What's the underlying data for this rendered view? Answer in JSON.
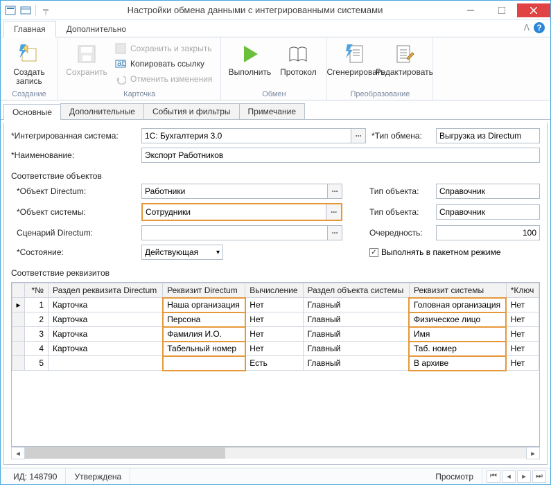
{
  "title": "Настройки обмена данными с интегрированными системами",
  "ribbon": {
    "tabs": {
      "main": "Главная",
      "extra": "Дополнительно"
    },
    "create": "Создать запись",
    "save": "Сохранить",
    "save_close": "Сохранить и закрыть",
    "copy_link": "Копировать ссылку",
    "cancel_changes": "Отменить изменения",
    "execute": "Выполнить",
    "protocol": "Протокол",
    "generate": "Сгенерировать",
    "edit": "Редактировать",
    "groups": {
      "creation": "Создание",
      "card": "Карточка",
      "exchange": "Обмен",
      "transform": "Преобразование"
    }
  },
  "pageTabs": {
    "main": "Основные",
    "extra": "Дополнительные",
    "events": "События и фильтры",
    "note": "Примечание"
  },
  "form": {
    "integratedSystemLabel": "*Интегрированная система:",
    "integratedSystemValue": "1С: Бухгалтерия 3.0",
    "exchangeTypeLabel": "*Тип обмена:",
    "exchangeTypeValue": "Выгрузка из Directum",
    "nameLabel": "*Наименование:",
    "nameValue": "Экспорт Работников",
    "objectsMapLabel": "Соответствие объектов",
    "directumObjectLabel": "*Объект Directum:",
    "directumObjectValue": "Работники",
    "objectTypeLabel": "Тип объекта:",
    "objectTypeValue1": "Справочник",
    "systemObjectLabel": "*Объект системы:",
    "systemObjectValue": "Сотрудники",
    "objectTypeValue2": "Справочник",
    "directumScenarioLabel": "Сценарий Directum:",
    "directumScenarioValue": "",
    "orderLabel": "Очередность:",
    "orderValue": "100",
    "stateLabel": "*Состояние:",
    "stateValue": "Действующая",
    "batchModeLabel": "Выполнять в пакетном режиме",
    "reqMapLabel": "Соответствие реквизитов"
  },
  "table": {
    "headers": {
      "num": "*№",
      "section": "Раздел реквизита Directum",
      "req_directum": "Реквизит Directum",
      "calc": "Вычисление",
      "sys_section": "Раздел объекта системы",
      "sys_req": "Реквизит системы",
      "key": "*Ключ"
    },
    "rows": [
      {
        "n": "1",
        "section": "Карточка",
        "req": "Наша организация",
        "calc": "Нет",
        "sys_sec": "Главный",
        "sys_req": "Головная организация",
        "key": "Нет"
      },
      {
        "n": "2",
        "section": "Карточка",
        "req": "Персона",
        "calc": "Нет",
        "sys_sec": "Главный",
        "sys_req": "Физическое лицо",
        "key": "Нет"
      },
      {
        "n": "3",
        "section": "Карточка",
        "req": "Фамилия И.О.",
        "calc": "Нет",
        "sys_sec": "Главный",
        "sys_req": "Имя",
        "key": "Нет"
      },
      {
        "n": "4",
        "section": "Карточка",
        "req": "Табельный номер",
        "calc": "Нет",
        "sys_sec": "Главный",
        "sys_req": "Таб. номер",
        "key": "Нет"
      },
      {
        "n": "5",
        "section": "",
        "req": "",
        "calc": "Есть",
        "sys_sec": "Главный",
        "sys_req": "В архиве",
        "key": "Нет"
      }
    ]
  },
  "status": {
    "id": "ИД: 148790",
    "state": "Утверждена",
    "preview": "Просмотр"
  }
}
